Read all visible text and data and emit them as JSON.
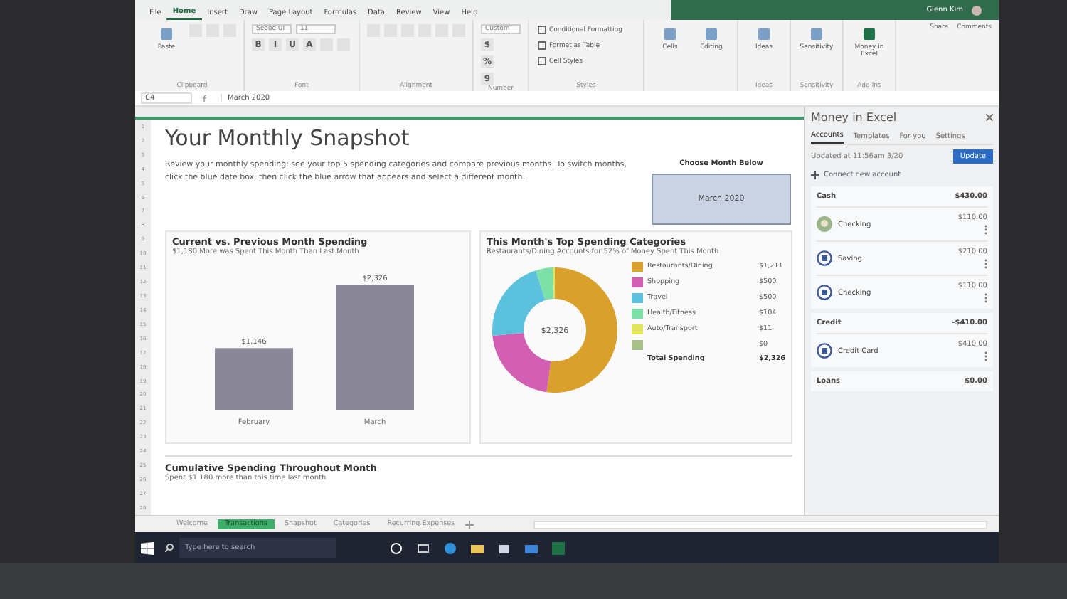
{
  "window": {
    "tabs": [
      {
        "label": "File",
        "selected": false
      },
      {
        "label": "Home",
        "selected": true
      },
      {
        "label": "Insert",
        "selected": false
      },
      {
        "label": "Draw",
        "selected": false
      },
      {
        "label": "Page Layout",
        "selected": false
      },
      {
        "label": "Formulas",
        "selected": false
      },
      {
        "label": "Data",
        "selected": false
      },
      {
        "label": "Review",
        "selected": false
      },
      {
        "label": "View",
        "selected": false
      },
      {
        "label": "Help",
        "selected": false
      }
    ],
    "user": "Glenn Kim",
    "share": "Share",
    "comments": "Comments"
  },
  "ribbon": {
    "groups": [
      {
        "label": "Clipboard",
        "items": [
          {
            "kind": "large",
            "label": "Paste"
          },
          {
            "kind": "icon"
          },
          {
            "kind": "icon"
          },
          {
            "kind": "icon"
          }
        ]
      },
      {
        "label": "Font",
        "items": [
          {
            "kind": "field",
            "value": "Segoe UI"
          },
          {
            "kind": "field",
            "value": "11"
          },
          {
            "kind": "glyph",
            "label": "B"
          },
          {
            "kind": "glyph",
            "label": "I"
          },
          {
            "kind": "glyph",
            "label": "U"
          },
          {
            "kind": "glyph",
            "label": "A"
          },
          {
            "kind": "icon"
          },
          {
            "kind": "icon"
          }
        ]
      },
      {
        "label": "Alignment",
        "items": [
          {
            "kind": "icon"
          },
          {
            "kind": "icon"
          },
          {
            "kind": "icon"
          },
          {
            "kind": "icon"
          },
          {
            "kind": "icon"
          },
          {
            "kind": "icon"
          }
        ]
      },
      {
        "label": "Number",
        "items": [
          {
            "kind": "field",
            "value": "Custom"
          },
          {
            "kind": "glyph",
            "label": "$"
          },
          {
            "kind": "glyph",
            "label": "%"
          },
          {
            "kind": "glyph",
            "label": "9"
          }
        ]
      },
      {
        "label": "Styles",
        "items": [
          {
            "kind": "small",
            "label": "Conditional Formatting"
          },
          {
            "kind": "small",
            "label": "Format as Table"
          },
          {
            "kind": "small",
            "label": "Cell Styles"
          }
        ]
      },
      {
        "items": [
          {
            "kind": "large",
            "label": "Cells"
          },
          {
            "kind": "large",
            "label": "Editing"
          }
        ]
      },
      {
        "label": "Ideas",
        "items": [
          {
            "kind": "large",
            "label": "Ideas"
          }
        ]
      },
      {
        "label": "Sensitivity",
        "items": [
          {
            "kind": "large",
            "label": "Sensitivity"
          }
        ]
      },
      {
        "label": "Add-ins",
        "items": [
          {
            "kind": "large",
            "label": "Money in Excel"
          }
        ]
      }
    ]
  },
  "formula_bar": {
    "cell": "C4",
    "value": "March 2020"
  },
  "sheet": {
    "row_headers": [
      "1",
      "2",
      "3",
      "4",
      "5",
      "6",
      "7",
      "8",
      "9",
      "10",
      "11",
      "12",
      "13",
      "14",
      "15",
      "16",
      "17",
      "18",
      "19",
      "20",
      "21",
      "22",
      "23",
      "24",
      "25",
      "26",
      "27",
      "28"
    ],
    "title": "Your Monthly Snapshot",
    "description": "Review your monthly spending: see your top 5 spending categories and compare previous months. To switch months, click the blue date box, then click the blue arrow that appears and select a different month.",
    "month_picker": {
      "label": "Choose Month Below",
      "value": "March 2020"
    },
    "comparison": {
      "title": "Current vs. Previous Month Spending",
      "subtitle": "$1,180 More was Spent This Month Than Last Month",
      "chart_data": {
        "type": "bar",
        "categories": [
          "February",
          "March"
        ],
        "values": [
          1146,
          2326
        ],
        "value_labels": [
          "$1,146",
          "$2,326"
        ]
      }
    },
    "categories": {
      "title": "This Month's Top Spending Categories",
      "subtitle": "Restaurants/Dining Accounts for 52% of Money Spent This Month",
      "center_label": "$2,326",
      "legend": [
        {
          "value": "$1,211",
          "color": "#d9a02b"
        },
        {
          "value": "$500",
          "color": "#d35fb2"
        },
        {
          "value": "$500",
          "color": "#5bc1dc"
        },
        {
          "value": "$104",
          "color": "#7de0a8"
        },
        {
          "value": "$11",
          "color": "#e2e55a"
        },
        {
          "value": "$0",
          "color": "#a8c08a"
        }
      ],
      "total_label": "Total Spending",
      "total_value": "$2,326",
      "chart_data": {
        "type": "donut",
        "categories": [
          "Restaurants/Dining",
          "Shopping",
          "Travel",
          "Health/Fitness",
          "Auto/Transport",
          null
        ],
        "values": [
          52.06,
          21.5,
          21.5,
          4.47,
          0.47,
          0
        ]
      }
    },
    "cumulative": {
      "title": "Cumulative Spending Throughout Month",
      "subtitle": "Spent $1,180 more than this time last month"
    }
  },
  "sheet_tabs": [
    {
      "label": "Welcome",
      "selected": false
    },
    {
      "label": "Transactions",
      "selected": true
    },
    {
      "label": "Snapshot",
      "selected": false
    },
    {
      "label": "Categories",
      "selected": false
    },
    {
      "label": "Recurring Expenses",
      "selected": false
    }
  ],
  "pane": {
    "title": "Money in Excel",
    "tabs": [
      {
        "label": "Accounts",
        "selected": true
      },
      {
        "label": "Templates",
        "selected": false
      },
      {
        "label": "For you",
        "selected": false
      },
      {
        "label": "Settings",
        "selected": false
      }
    ],
    "updated": "Updated at 11:56am 3/20",
    "update_button": "Update",
    "connect": "Connect new account",
    "groups": [
      {
        "name": "Cash",
        "total": "$430.00",
        "accounts": [
          {
            "kind": "photo",
            "name": "Checking",
            "amount": "$110.00"
          },
          {
            "kind": "bank",
            "name": "Saving",
            "amount": "$210.00"
          },
          {
            "kind": "bank",
            "name": "Checking",
            "amount": "$110.00"
          }
        ]
      },
      {
        "name": "Credit",
        "total": "-$410.00",
        "accounts": [
          {
            "kind": "bank",
            "name": "Credit Card",
            "amount": "$410.00"
          }
        ]
      },
      {
        "name": "Loans",
        "total": "$0.00"
      }
    ]
  },
  "taskbar": {
    "search_placeholder": "Type here to search"
  }
}
